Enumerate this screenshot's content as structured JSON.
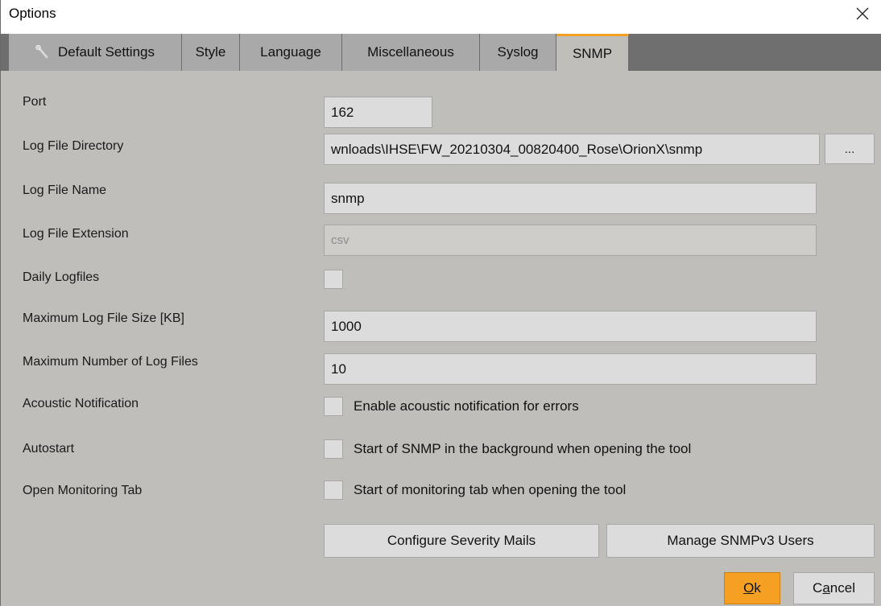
{
  "window": {
    "title": "Options",
    "close_icon": "close-icon"
  },
  "tabs": [
    {
      "label": "Default Settings",
      "icon": "wrench-icon",
      "active": false
    },
    {
      "label": "Style",
      "active": false
    },
    {
      "label": "Language",
      "active": false
    },
    {
      "label": "Miscellaneous",
      "active": false
    },
    {
      "label": "Syslog",
      "active": false
    },
    {
      "label": "SNMP",
      "active": true
    }
  ],
  "form": {
    "port_label": "Port",
    "port_value": "162",
    "log_dir_label": "Log File Directory",
    "log_dir_value": "wnloads\\IHSE\\FW_20210304_00820400_Rose\\OrionX\\snmp",
    "browse_label": "...",
    "log_name_label": "Log File Name",
    "log_name_value": "snmp",
    "log_ext_label": "Log File Extension",
    "log_ext_value": "csv",
    "daily_label": "Daily Logfiles",
    "daily_checked": false,
    "max_size_label": "Maximum Log File Size [KB]",
    "max_size_value": "1000",
    "max_files_label": "Maximum Number of Log Files",
    "max_files_value": "10",
    "acoustic_label": "Acoustic Notification",
    "acoustic_text": "Enable acoustic notification for errors",
    "acoustic_checked": false,
    "autostart_label": "Autostart",
    "autostart_text": "Start of SNMP in the background when opening the tool",
    "autostart_checked": false,
    "monitoring_label": "Open Monitoring Tab",
    "monitoring_text": "Start of monitoring tab when opening the tool",
    "monitoring_checked": false
  },
  "actions": {
    "severity_mails": "Configure Severity Mails",
    "manage_users": "Manage SNMPv3 Users",
    "ok_mnemonic": "O",
    "ok_rest": "k",
    "cancel_prefix": "C",
    "cancel_mnemonic": "a",
    "cancel_rest": "ncel"
  },
  "colors": {
    "accent": "#f5a023",
    "panel_bg": "#bfbebb",
    "tab_bg": "#a9a9a9",
    "tabbar_bg": "#6f6f6f",
    "field_bg": "#dcdcdc"
  }
}
